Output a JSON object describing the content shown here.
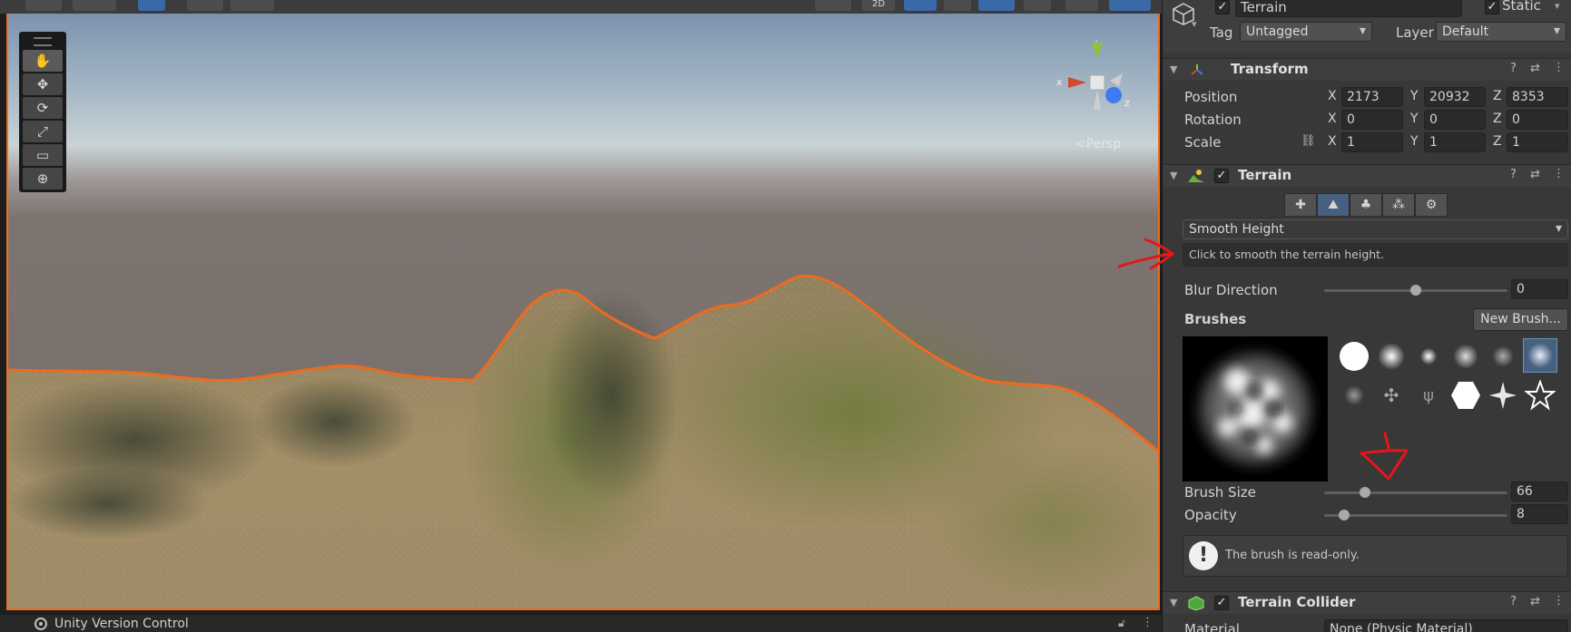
{
  "scene": {
    "toolbar_2d_label": "2D",
    "persp_label": "Persp",
    "gizmo": {
      "x_label": "x",
      "y_label": "y",
      "z_label": "z"
    },
    "tools": [
      {
        "name": "hand-tool",
        "glyph": "✋"
      },
      {
        "name": "move-tool",
        "glyph": "✥"
      },
      {
        "name": "rotate-tool",
        "glyph": "⟳"
      },
      {
        "name": "scale-tool",
        "glyph": "⤢"
      },
      {
        "name": "rect-tool",
        "glyph": "▭"
      },
      {
        "name": "transform-tool",
        "glyph": "⊕"
      }
    ]
  },
  "status_bar": {
    "version_control_label": "Unity Version Control"
  },
  "inspector": {
    "object": {
      "name": "Terrain",
      "active": true,
      "static_label": "Static",
      "static_checked": true,
      "tag_label": "Tag",
      "tag_value": "Untagged",
      "layer_label": "Layer",
      "layer_value": "Default"
    },
    "transform": {
      "title": "Transform",
      "position_label": "Position",
      "rotation_label": "Rotation",
      "scale_label": "Scale",
      "position": {
        "x": "2173",
        "y": "20932",
        "z": "8353"
      },
      "rotation": {
        "x": "0",
        "y": "0",
        "z": "0"
      },
      "scale": {
        "x": "1",
        "y": "1",
        "z": "1"
      },
      "axis_x": "X",
      "axis_y": "Y",
      "axis_z": "Z"
    },
    "terrain": {
      "title": "Terrain",
      "enabled": true,
      "tool_dropdown": "Smooth Height",
      "help_text": "Click to smooth the terrain height.",
      "blur_direction_label": "Blur Direction",
      "blur_direction_value": "0",
      "blur_direction_fraction": 0.5,
      "brushes_label": "Brushes",
      "new_brush_label": "New Brush...",
      "brush_size_label": "Brush Size",
      "brush_size_value": "66",
      "brush_size_fraction": 0.22,
      "opacity_label": "Opacity",
      "opacity_value": "8",
      "opacity_fraction": 0.1,
      "readonly_message": "The brush is read-only."
    },
    "terrain_collider": {
      "title": "Terrain Collider",
      "enabled": true,
      "material_label": "Material",
      "material_value": "None (Physic Material)"
    }
  },
  "colors": {
    "accent_blue": "#46607f",
    "selection_outline": "#f06a1e",
    "annotation_red": "#e8141c",
    "panel_bg": "#383838"
  }
}
